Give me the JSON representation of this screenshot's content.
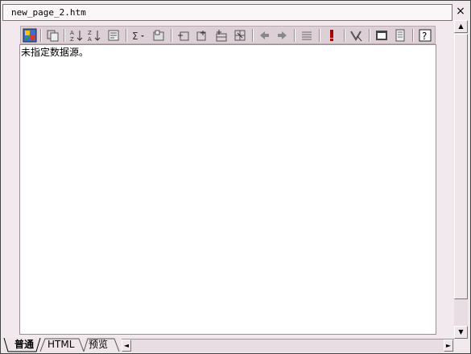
{
  "window": {
    "title": "new_page_2.htm",
    "close_glyph": "×"
  },
  "toolbar": {
    "buttons": [
      {
        "icon": "database-wizard-icon"
      },
      {
        "icon": "copy-query-icon"
      },
      {
        "icon": "sort-ascending-icon"
      },
      {
        "icon": "sort-descending-icon"
      },
      {
        "icon": "filter-icon"
      },
      {
        "icon": "sum-icon"
      },
      {
        "icon": "group-icon"
      },
      {
        "icon": "insert-column-left-icon"
      },
      {
        "icon": "insert-column-right-icon"
      },
      {
        "icon": "insert-row-icon"
      },
      {
        "icon": "merge-icon"
      },
      {
        "icon": "arrow-left-icon"
      },
      {
        "icon": "arrow-right-icon"
      },
      {
        "icon": "properties-list-icon"
      },
      {
        "icon": "exclamation-icon"
      },
      {
        "icon": "clear-format-icon"
      },
      {
        "icon": "page-setup-icon"
      },
      {
        "icon": "page-icon"
      },
      {
        "icon": "help-icon"
      }
    ]
  },
  "canvas": {
    "message": "未指定数据源。"
  },
  "tabs": [
    {
      "label": "普通",
      "active": true
    },
    {
      "label": "HTML",
      "active": false
    },
    {
      "label": "预览",
      "active": false
    }
  ],
  "scroll": {
    "up": "▲",
    "down": "▼",
    "left": "◄",
    "right": "►"
  }
}
